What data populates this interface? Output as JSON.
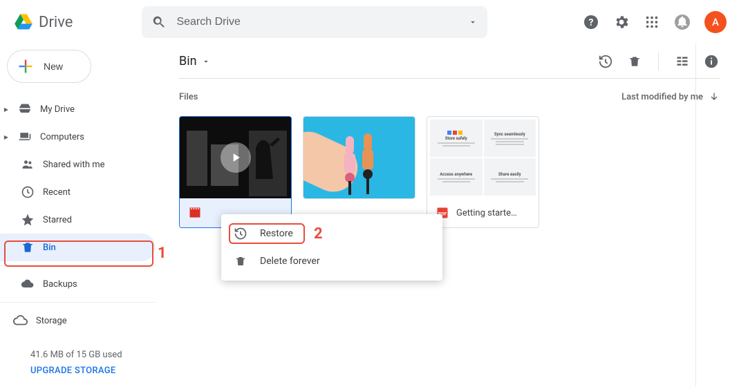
{
  "app": {
    "title": "Drive"
  },
  "search": {
    "placeholder": "Search Drive"
  },
  "header_avatar": {
    "letter": "A"
  },
  "new_button": {
    "label": "New"
  },
  "sidebar": {
    "my_drive": "My Drive",
    "computers": "Computers",
    "shared": "Shared with me",
    "recent": "Recent",
    "starred": "Starred",
    "bin": "Bin",
    "backups": "Backups",
    "storage": "Storage",
    "storage_detail": "41.6 MB of 15 GB used",
    "storage_link": "UPGRADE STORAGE"
  },
  "page": {
    "title": "Bin",
    "section_label": "Files",
    "sort_label": "Last modified by me"
  },
  "files": {
    "video_name": "",
    "doc_name": "Getting starte…"
  },
  "doc_thumb": {
    "c1": "Store safely",
    "c2": "Sync seamlessly",
    "c3": "Access anywhere",
    "c4": "Share easily"
  },
  "context_menu": {
    "restore": "Restore",
    "delete": "Delete forever"
  },
  "annotations": {
    "n1": "1",
    "n2": "2"
  }
}
